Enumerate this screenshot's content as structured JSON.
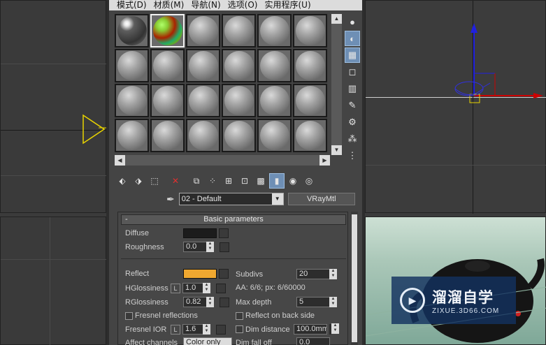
{
  "menu": [
    "模式(D)",
    "材质(M)",
    "导航(N)",
    "选项(O)",
    "实用程序(U)"
  ],
  "slots": {
    "rows": 4,
    "cols": 6,
    "active_index": 1
  },
  "material": {
    "name": "02 - Default",
    "type": "VRayMtl"
  },
  "rollout": {
    "title": "Basic parameters",
    "collapse_symbol": "-",
    "diffuse_label": "Diffuse",
    "roughness_label": "Roughness",
    "roughness_value": "0.0",
    "reflect_label": "Reflect",
    "subdivs_label": "Subdivs",
    "subdivs_value": "20",
    "hglossiness_label": "HGlossiness",
    "hglossiness_lock": "L",
    "hglossiness_value": "1.0",
    "aa_info": "AA: 6/6; px: 6/60000",
    "rglossiness_label": "RGlossiness",
    "rglossiness_value": "0.82",
    "max_depth_label": "Max depth",
    "max_depth_value": "5",
    "fresnel_label": "Fresnel reflections",
    "reflect_back_label": "Reflect on back side",
    "fresnel_ior_label": "Fresnel IOR",
    "fresnel_ior_lock": "L",
    "fresnel_ior_value": "1.6",
    "dim_distance_label": "Dim distance",
    "dim_distance_value": "100.0mm",
    "affect_channels_label": "Affect channels",
    "affect_channels_value": "Color only",
    "dim_falloff_label": "Dim fall off",
    "dim_falloff_value": "0.0"
  },
  "colors": {
    "diffuse": "#1c1c1c",
    "reflect": "#f0a830"
  },
  "watermark": {
    "title": "溜溜自学",
    "url": "ZIXUE.3D66.COM"
  }
}
